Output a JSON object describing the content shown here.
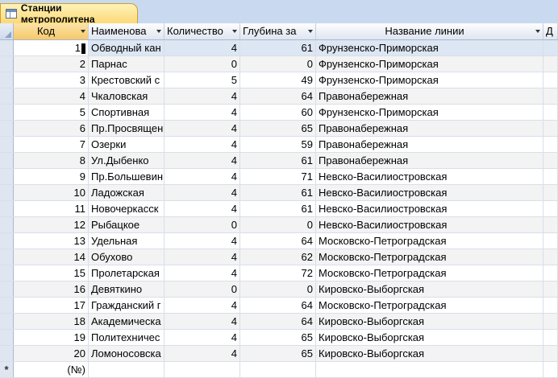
{
  "tab": {
    "title": "Станции метрополитена"
  },
  "columns": [
    {
      "label": "Код"
    },
    {
      "label": "Наименова"
    },
    {
      "label": "Количество"
    },
    {
      "label": "Глубина за"
    },
    {
      "label": "Название линии"
    },
    {
      "label": "Д"
    }
  ],
  "rows": [
    [
      "1",
      "Обводный кан",
      "4",
      "61",
      "Фрунзенско-Приморская"
    ],
    [
      "2",
      "Парнас",
      "0",
      "0",
      "Фрунзенско-Приморская"
    ],
    [
      "3",
      "Крестовский с",
      "5",
      "49",
      "Фрунзенско-Приморская"
    ],
    [
      "4",
      "Чкаловская",
      "4",
      "64",
      "Правонабережная"
    ],
    [
      "5",
      "Спортивная",
      "4",
      "60",
      "Фрунзенско-Приморская"
    ],
    [
      "6",
      "Пр.Просвящен",
      "4",
      "65",
      "Правонабережная"
    ],
    [
      "7",
      "Озерки",
      "4",
      "59",
      "Правонабережная"
    ],
    [
      "8",
      "Ул.Дыбенко",
      "4",
      "61",
      "Правонабережная"
    ],
    [
      "9",
      "Пр.Большевин",
      "4",
      "71",
      "Невско-Василиостровская"
    ],
    [
      "10",
      "Ладожская",
      "4",
      "61",
      "Невско-Василиостровская"
    ],
    [
      "11",
      "Новочеркасск",
      "4",
      "61",
      "Невско-Василиостровская"
    ],
    [
      "12",
      "Рыбацкое",
      "0",
      "0",
      "Невско-Василиостровская"
    ],
    [
      "13",
      "Удельная",
      "4",
      "64",
      "Московско-Петроградская"
    ],
    [
      "14",
      "Обухово",
      "4",
      "62",
      "Московско-Петроградская"
    ],
    [
      "15",
      "Пролетарская",
      "4",
      "72",
      "Московско-Петроградская"
    ],
    [
      "16",
      "Девяткино",
      "0",
      "0",
      "Кировско-Выборгская"
    ],
    [
      "17",
      "Гражданский г",
      "4",
      "64",
      "Московско-Петроградская"
    ],
    [
      "18",
      "Академическа",
      "4",
      "64",
      "Кировско-Выборгская"
    ],
    [
      "19",
      "Политехничес",
      "4",
      "65",
      "Кировско-Выборгская"
    ],
    [
      "20",
      "Ломоносовска",
      "4",
      "65",
      "Кировско-Выборгская"
    ]
  ],
  "new_row": {
    "marker": "*",
    "placeholder": "(№)"
  }
}
